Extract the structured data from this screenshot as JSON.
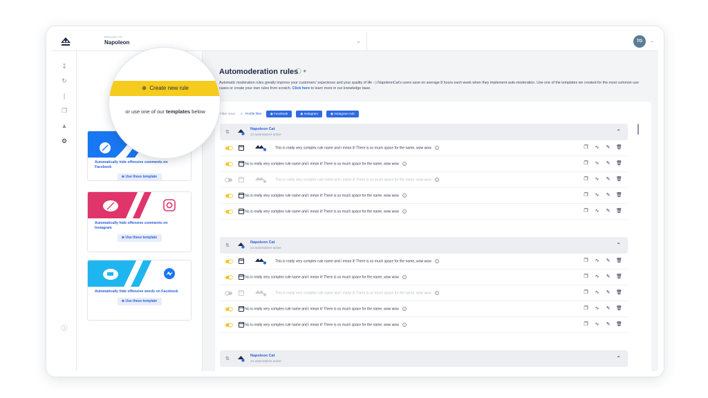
{
  "header": {
    "project_label": "PROJECTS",
    "project_name": "Napoleon",
    "user_initials": "TO"
  },
  "rail_icons": [
    "download-icon",
    "refresh-icon",
    "analytics-icon",
    "copy-icon",
    "megaphone-icon",
    "settings-icon",
    "info-icon"
  ],
  "templates_panel": {
    "create_button": "Create new rule",
    "or_text_prefix": "or use one of our",
    "or_text_bold": "templates",
    "or_text_suffix": "below",
    "cards": [
      {
        "title": "Automatically hide offensive comments on Facebook",
        "button": "Use these template",
        "banner": "facebook",
        "color": "#1877f2"
      },
      {
        "title": "Automatically hide offensive comments on Instagram",
        "button": "Use these template",
        "banner": "instagram",
        "color": "#e0356b"
      },
      {
        "title": "Automatically hide offensive words on Facebook",
        "button": "Use these template",
        "banner": "messenger",
        "color": "#1fb6f0"
      }
    ]
  },
  "main": {
    "title": "Automoderation rules",
    "description": "Automatic moderation rules greatly improve your customers' experience and your quality of life :-) NapoleonCat's users save on average 8 hours each week when they implement auto-moderation. Use one of the templates we created for the most common use cases or create your own rules from scratch.",
    "click_here": "Click here",
    "description_tail": "to learn more in our knowledge base.",
    "filter_label": "Filter view:",
    "profile_filter": "Profile filter",
    "chips": [
      "Facebook",
      "Instagram",
      "Instagram Ads"
    ]
  },
  "groups": [
    {
      "name": "Napoleon Cat",
      "sub": "14 automations active",
      "rules": [
        {
          "text": "This is really very complex rule name and i mean it! There is so much space for the name, wow wow",
          "on": true,
          "cal": true,
          "mini": true
        },
        {
          "text": "This is really very complex rule name and i mean it! There is so much space for the name, wow wow",
          "on": true,
          "cal": true,
          "mini": false
        },
        {
          "text": "This is really very complex rule name and i mean it! There is so much space for the name, wow wow",
          "on": false,
          "cal": true,
          "mini": true
        },
        {
          "text": "This is really very complex rule name and i mean it! There is so much space for the name, wow wow",
          "on": true,
          "cal": true,
          "mini": false
        },
        {
          "text": "This is really very complex rule name and i mean it! There is so much space for the name, wow wow",
          "on": true,
          "cal": true,
          "mini": false
        }
      ]
    },
    {
      "name": "Napoleon Cat",
      "sub": "14 automations active",
      "rules": [
        {
          "text": "This is really very complex rule name and i mean it! There is so much space for the name, wow wow",
          "on": true,
          "cal": true,
          "mini": true
        },
        {
          "text": "This is really very complex rule name and i mean it! There is so much space for the name, wow wow",
          "on": true,
          "cal": true,
          "mini": false
        },
        {
          "text": "This is really very complex rule name and i mean it! There is so much space for the name, wow wow",
          "on": false,
          "cal": true,
          "mini": true
        },
        {
          "text": "This is really very complex rule name and i mean it! There is so much space for the name, wow wow",
          "on": true,
          "cal": true,
          "mini": false
        },
        {
          "text": "This is really very complex rule name and i mean it! There is so much space for the name, wow wow",
          "on": true,
          "cal": true,
          "mini": false
        }
      ]
    },
    {
      "name": "Napoleon Cat",
      "sub": "14 automations active",
      "rules": []
    }
  ],
  "colors": {
    "accent": "#f5cb1d",
    "link": "#2b5fd9",
    "chip": "#2f6ae0"
  }
}
